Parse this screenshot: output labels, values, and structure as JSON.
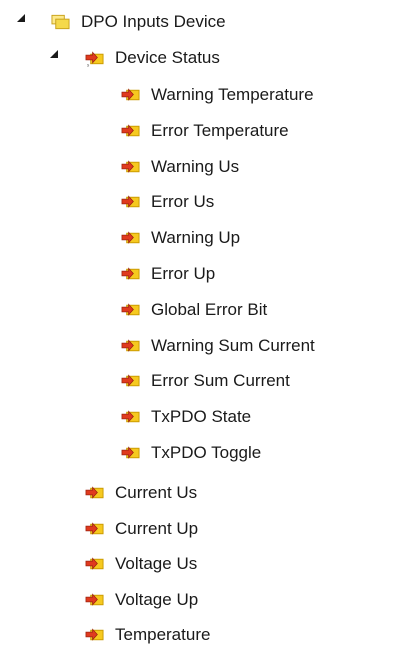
{
  "tree": {
    "root": {
      "label": "DPO Inputs Device",
      "icon": "folder-input-icon",
      "expanded": true,
      "children": {
        "device_status": {
          "label": "Device Status",
          "icon": "input-variable-group-icon",
          "expanded": true,
          "items": [
            {
              "label": "Warning Temperature",
              "icon": "input-variable-icon"
            },
            {
              "label": "Error Temperature",
              "icon": "input-variable-icon"
            },
            {
              "label": "Warning Us",
              "icon": "input-variable-icon"
            },
            {
              "label": "Error Us",
              "icon": "input-variable-icon"
            },
            {
              "label": "Warning Up",
              "icon": "input-variable-icon"
            },
            {
              "label": "Error Up",
              "icon": "input-variable-icon"
            },
            {
              "label": "Global Error Bit",
              "icon": "input-variable-icon"
            },
            {
              "label": "Warning Sum Current",
              "icon": "input-variable-icon"
            },
            {
              "label": "Error Sum Current",
              "icon": "input-variable-icon"
            },
            {
              "label": "TxPDO State",
              "icon": "input-variable-icon"
            },
            {
              "label": "TxPDO Toggle",
              "icon": "input-variable-icon"
            }
          ]
        },
        "items": [
          {
            "label": "Current Us",
            "icon": "input-variable-icon"
          },
          {
            "label": "Current Up",
            "icon": "input-variable-icon"
          },
          {
            "label": "Voltage Us",
            "icon": "input-variable-icon"
          },
          {
            "label": "Voltage Up",
            "icon": "input-variable-icon"
          },
          {
            "label": "Temperature",
            "icon": "input-variable-icon"
          }
        ]
      }
    }
  },
  "colors": {
    "folder_fill": "#f5d94a",
    "folder_stroke": "#c8a11b",
    "variable_fill": "#f6c91f",
    "arrow": "#e03a1e"
  }
}
